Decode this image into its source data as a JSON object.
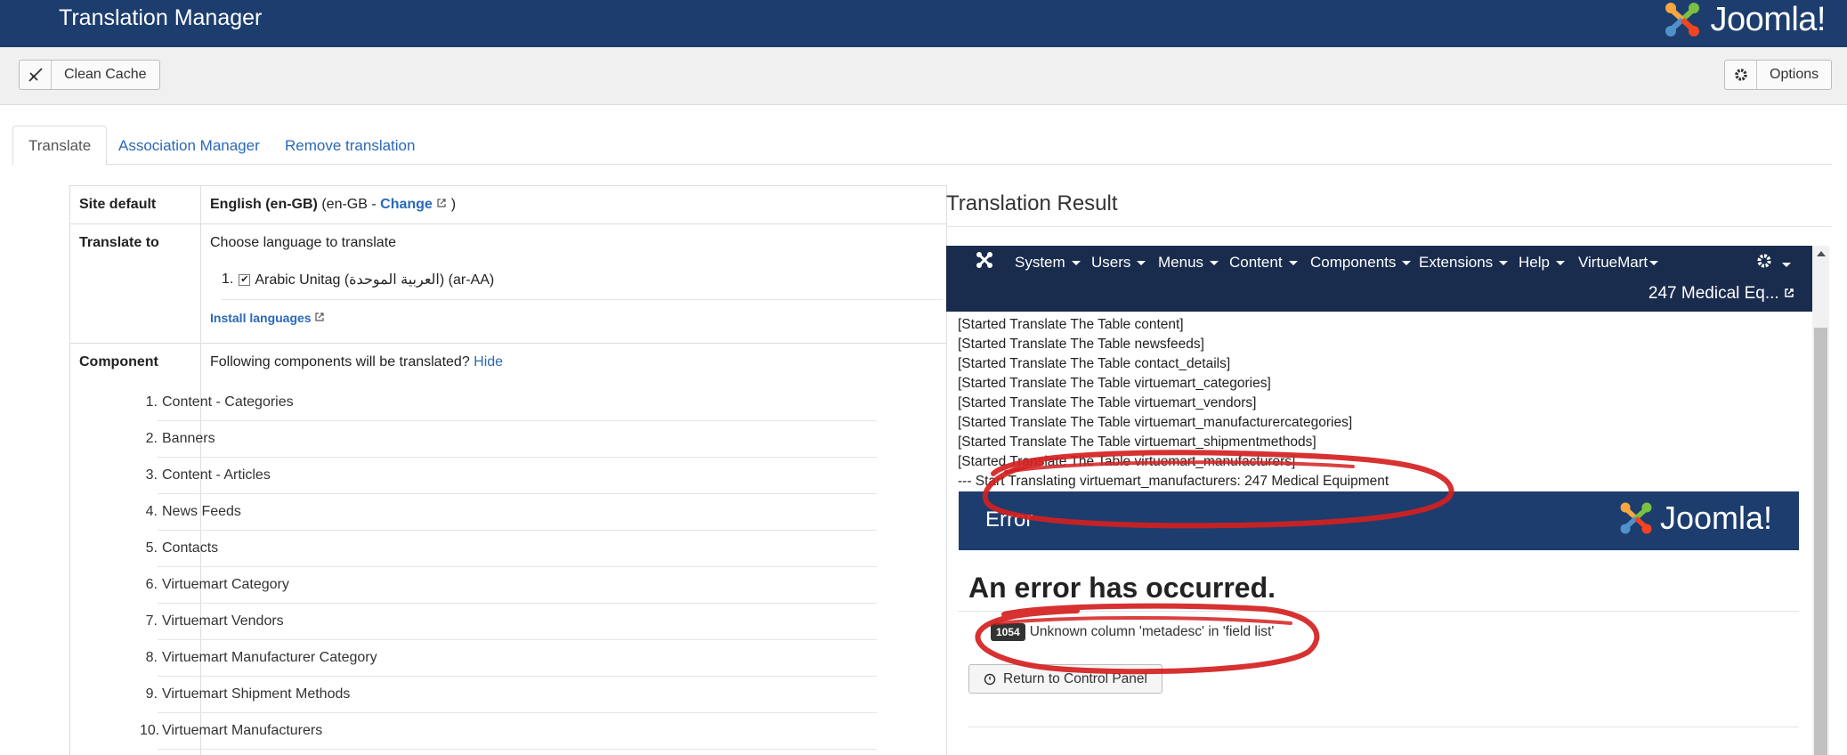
{
  "header": {
    "title": "Translation Manager",
    "brand": "Joomla!"
  },
  "toolbar": {
    "clean_cache": "Clean Cache",
    "options": "Options"
  },
  "tabs": [
    {
      "label": "Translate",
      "active": true
    },
    {
      "label": "Association Manager"
    },
    {
      "label": "Remove translation"
    }
  ],
  "site_default": {
    "label": "Site default",
    "language": "English (en-GB)",
    "code_prefix": "(en-GB - ",
    "change_link": "Change",
    "code_suffix": ")"
  },
  "translate_to": {
    "label": "Translate to",
    "hint": "Choose language to translate",
    "item_number": "1.",
    "item_label": "Arabic Unitag (العربية الموحدة) (ar-AA)",
    "install_link": "Install languages"
  },
  "component": {
    "label": "Component",
    "hint": "Following components will be translated?",
    "hide_link": "Hide",
    "items": [
      "Content - Categories",
      "Banners",
      "Content - Articles",
      "News Feeds",
      "Contacts",
      "Virtuemart Category",
      "Virtuemart Vendors",
      "Virtuemart Manufacturer Category",
      "Virtuemart Shipment Methods",
      "Virtuemart Manufacturers"
    ]
  },
  "result": {
    "title": "Translation Result",
    "nav": [
      "System",
      "Users",
      "Menus",
      "Content",
      "Components",
      "Extensions",
      "Help",
      "VirtueMart"
    ],
    "site_link": "247 Medical Eq...",
    "log": [
      "[Started Translate The Table content]",
      "[Started Translate The Table newsfeeds]",
      "[Started Translate The Table contact_details]",
      "[Started Translate The Table virtuemart_categories]",
      "[Started Translate The Table virtuemart_vendors]",
      "[Started Translate The Table virtuemart_manufacturercategories]",
      "[Started Translate The Table virtuemart_shipmentmethods]",
      "[Started Translate The Table virtuemart_manufacturers]"
    ],
    "log_last": "--- Start Translating virtuemart_manufacturers: 247 Medical Equipment",
    "error_header": "Error",
    "error_title": "An error has occurred.",
    "error_code": "1054",
    "error_message": "Unknown column 'metadesc' in 'field list'",
    "return_button": "Return to Control Panel"
  },
  "colors": {
    "header": "#1c3d6e",
    "inner_nav": "#1a2c4e",
    "link": "#2a69b8",
    "annotation": "#d42020"
  },
  "icons": [
    "joomla-logo-icon",
    "broom-icon",
    "gear-icon",
    "external-link-icon",
    "checkbox-icon",
    "info-circle-icon"
  ]
}
